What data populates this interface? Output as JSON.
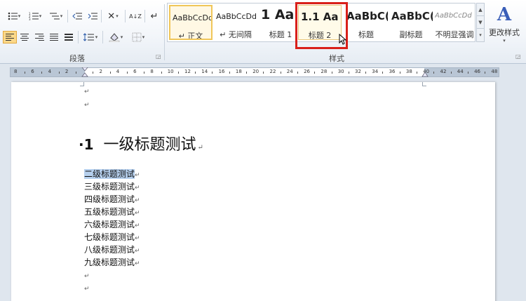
{
  "ribbon": {
    "paragraph_group": {
      "label": "段落",
      "row1_icons": [
        "bullet-list-icon",
        "numbered-list-icon",
        "multilevel-list-icon",
        "decrease-indent-icon",
        "increase-indent-icon",
        "asian-layout-icon",
        "sort-icon",
        "show-marks-icon"
      ],
      "row2_icons": [
        "align-left-icon",
        "align-center-icon",
        "align-right-icon",
        "justify-icon",
        "distributed-icon",
        "line-spacing-icon",
        "shading-icon",
        "borders-icon"
      ],
      "glyphs": {
        "asian": "✕",
        "sort": "A↓Z",
        "marks": "↵"
      }
    },
    "styles_group": {
      "label": "样式",
      "items": [
        {
          "preview": "AaBbCcDd",
          "name": "↵ 正文"
        },
        {
          "preview": "AaBbCcDd",
          "name": "↵ 无间隔"
        },
        {
          "preview": "1 Aa",
          "name": "标题 1"
        },
        {
          "preview": "1.1 Aa",
          "name": "标题 2"
        },
        {
          "preview": "AaBbC(",
          "name": "标题"
        },
        {
          "preview": "AaBbC(",
          "name": "副标题"
        },
        {
          "preview": "AaBbCcDd",
          "name": "不明显强调"
        }
      ],
      "change_styles": {
        "label": "更改样式",
        "glyph": "A"
      }
    }
  },
  "ruler": {
    "ticks": [
      "8",
      "6",
      "4",
      "2",
      "",
      "2",
      "4",
      "6",
      "8",
      "10",
      "12",
      "14",
      "16",
      "18",
      "20",
      "22",
      "24",
      "26",
      "28",
      "30",
      "32",
      "34",
      "36",
      "38",
      "40",
      "42",
      "44",
      "46",
      "48"
    ]
  },
  "document": {
    "para_mark": "↵",
    "heading1": {
      "number": "·1",
      "text": "一级标题测试"
    },
    "lines": [
      "二级标题测试",
      "三级标题测试",
      "四级标题测试",
      "五级标题测试",
      "六级标题测试",
      "七级标题测试",
      "八级标题测试",
      "九级标题测试"
    ]
  },
  "colors": {
    "highlight_box": "#d9201a",
    "selection": "#b6d0ee",
    "active_align": "#fbd889"
  }
}
